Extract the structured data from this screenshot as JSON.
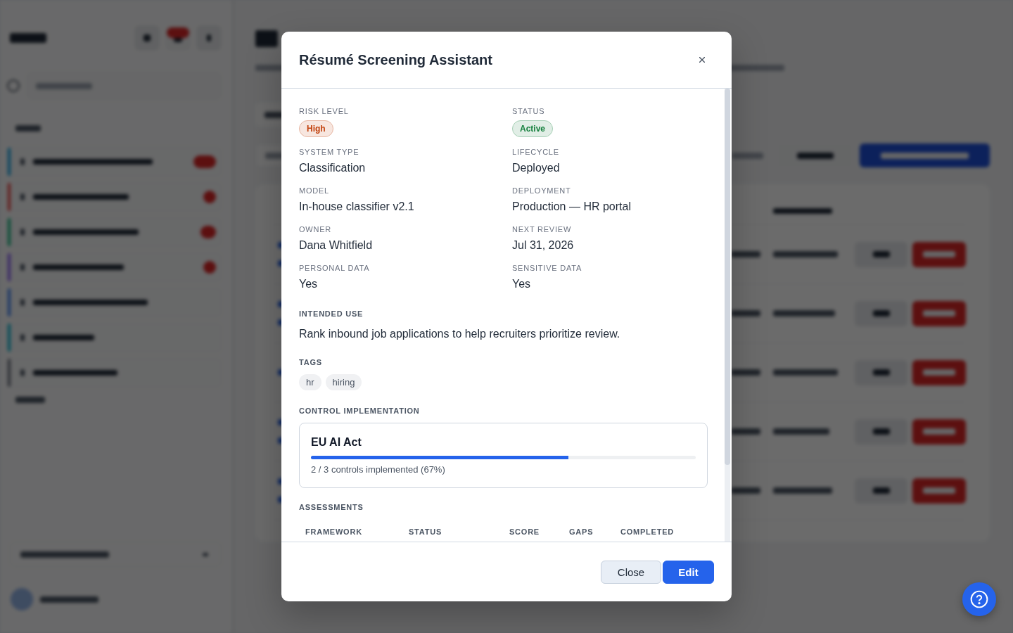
{
  "modal": {
    "title": "Résumé Screening Assistant",
    "fields": [
      {
        "label": "RISK LEVEL",
        "kind": "badge",
        "value": "High",
        "color": "#c2410c"
      },
      {
        "label": "STATUS",
        "kind": "badge",
        "value": "Active",
        "color": "#15803d"
      },
      {
        "label": "SYSTEM TYPE",
        "kind": "text",
        "value": "Classification"
      },
      {
        "label": "LIFECYCLE",
        "kind": "text",
        "value": "Deployed"
      },
      {
        "label": "MODEL",
        "kind": "text",
        "value": "In-house classifier v2.1"
      },
      {
        "label": "DEPLOYMENT",
        "kind": "text",
        "value": "Production — HR portal"
      },
      {
        "label": "OWNER",
        "kind": "text",
        "value": "Dana Whitfield"
      },
      {
        "label": "NEXT REVIEW",
        "kind": "text",
        "value": "Jul 31, 2026"
      },
      {
        "label": "PERSONAL DATA",
        "kind": "text",
        "value": "Yes"
      },
      {
        "label": "SENSITIVE DATA",
        "kind": "text",
        "value": "Yes"
      }
    ],
    "intended_use": {
      "label": "INTENDED USE",
      "text": "Rank inbound job applications to help recruiters prioritize review."
    },
    "tags": {
      "label": "TAGS",
      "items": [
        "hr",
        "hiring"
      ]
    },
    "control_implementation": {
      "label": "CONTROL IMPLEMENTATION",
      "frameworks": [
        {
          "name": "EU AI Act",
          "level": 0.67,
          "caption": "2 / 3 controls implemented (67%)"
        }
      ]
    },
    "assessments": {
      "label": "ASSESSMENTS",
      "columns": [
        "FRAMEWORK",
        "STATUS",
        "SCORE",
        "GAPS",
        "COMPLETED"
      ]
    },
    "buttons": [
      {
        "kind": "secondary",
        "label": "Close"
      },
      {
        "kind": "primary",
        "label": "Edit"
      }
    ]
  }
}
